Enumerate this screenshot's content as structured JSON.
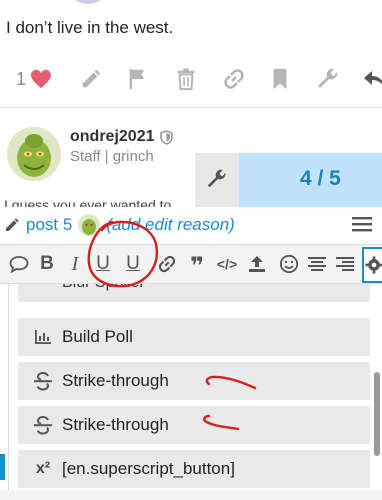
{
  "post1": {
    "text": "I don’t live in the west.",
    "like_count": "1"
  },
  "post2": {
    "username": "ondrej2021",
    "user_title": "Staff | grinch",
    "cut_text": "I guess you ever wanted to",
    "timeline": "4 / 5"
  },
  "editor": {
    "post_ref": "post 5",
    "edit_reason": "(add edit reason)"
  },
  "dropdown": {
    "partial_item": "Blur Spoiler",
    "items": [
      {
        "label": "Build Poll",
        "icon": "chart-icon"
      },
      {
        "label": "Strike-through",
        "icon": "strikethrough-icon"
      },
      {
        "label": "Strike-through",
        "icon": "strikethrough-icon"
      },
      {
        "label": "[en.superscript_button]",
        "icon": "superscript-icon",
        "icon_text": "x²"
      }
    ]
  },
  "colors": {
    "accent": "#1a8cc8",
    "like": "#e45f6f",
    "annotation": "#d61f1f"
  }
}
